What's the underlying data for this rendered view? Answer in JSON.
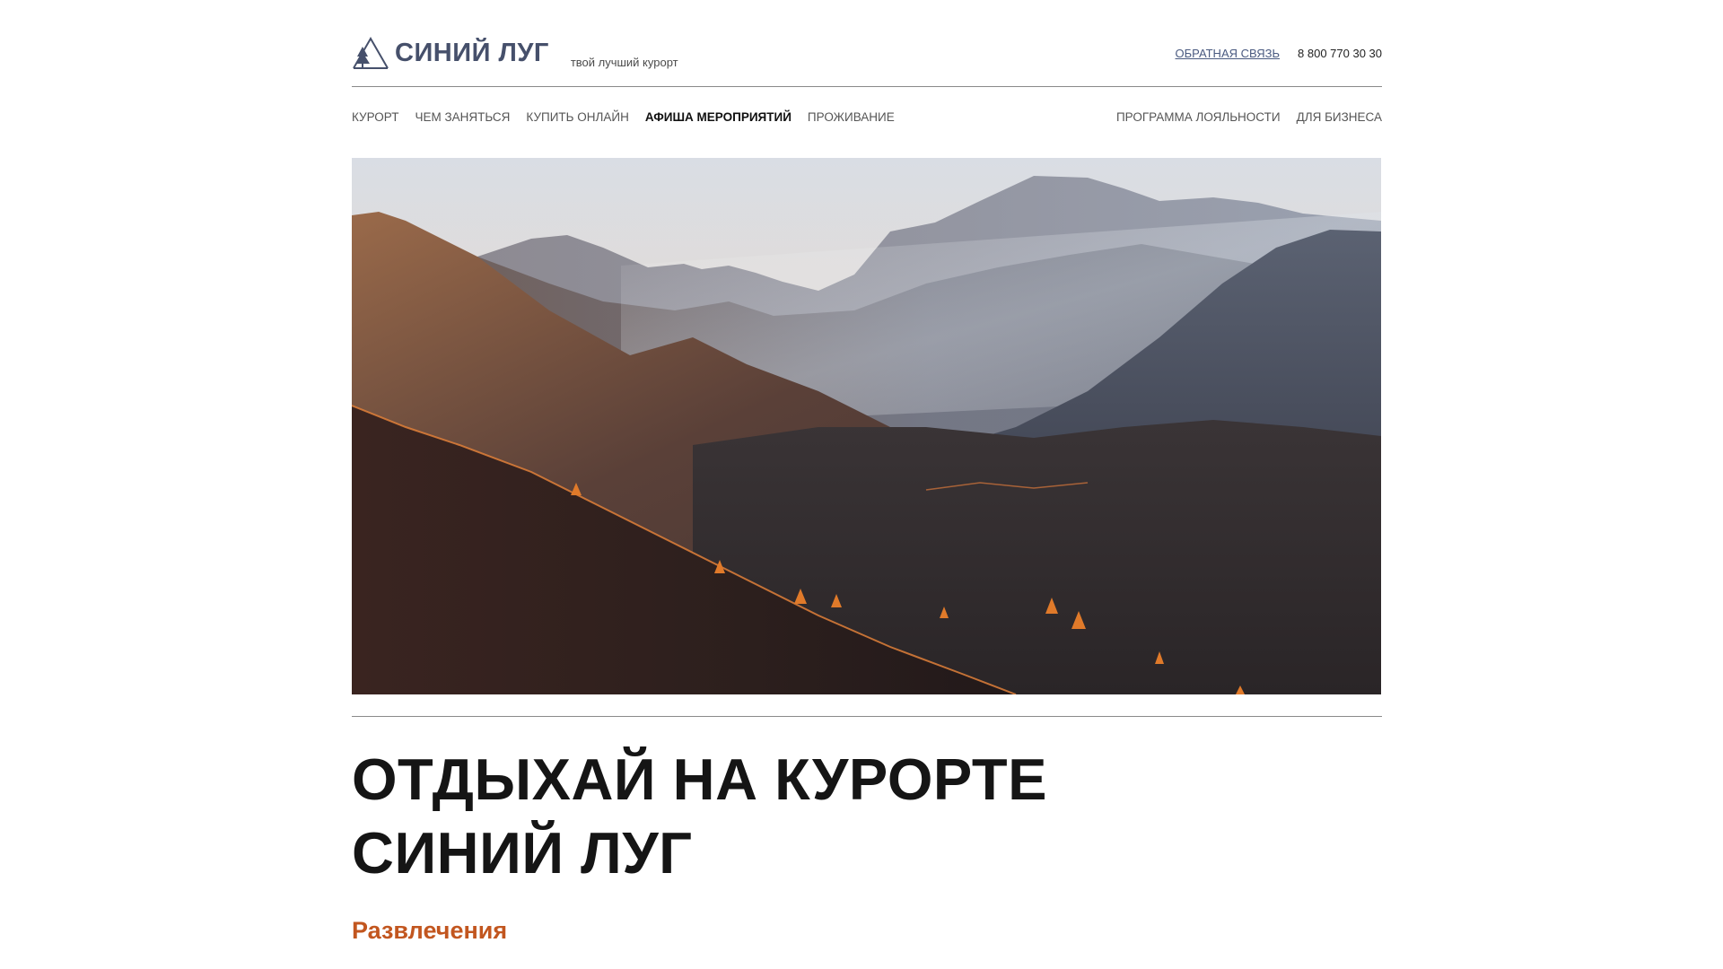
{
  "header": {
    "logo_text": "СИНИЙ ЛУГ",
    "tagline": "твой лучший курорт",
    "feedback_label": "ОБРАТНАЯ СВЯЗЬ",
    "phone": "8 800 770 30 30"
  },
  "nav": {
    "left": [
      "КУРОРТ",
      "ЧЕМ ЗАНЯТЬСЯ",
      "КУПИТЬ ОНЛАЙН",
      "АФИША МЕРОПРИЯТИЙ",
      "ПРОЖИВАНИЕ"
    ],
    "active": "АФИША МЕРОПРИЯТИЙ",
    "right": [
      "ПРОГРАММА ЛОЯЛЬНОСТИ",
      "ДЛЯ БИЗНЕСА"
    ]
  },
  "hero": {
    "icon": "mountain-landscape-photo"
  },
  "main": {
    "headline_line1": "ОТДЫХАЙ НА КУРОРТЕ",
    "headline_line2": "СИНИЙ ЛУГ",
    "section_title": "Развлечения"
  },
  "colors": {
    "brand": "#46506b",
    "accent": "#c2561f",
    "link": "#4a5a80",
    "divider": "#8a8a8a"
  }
}
